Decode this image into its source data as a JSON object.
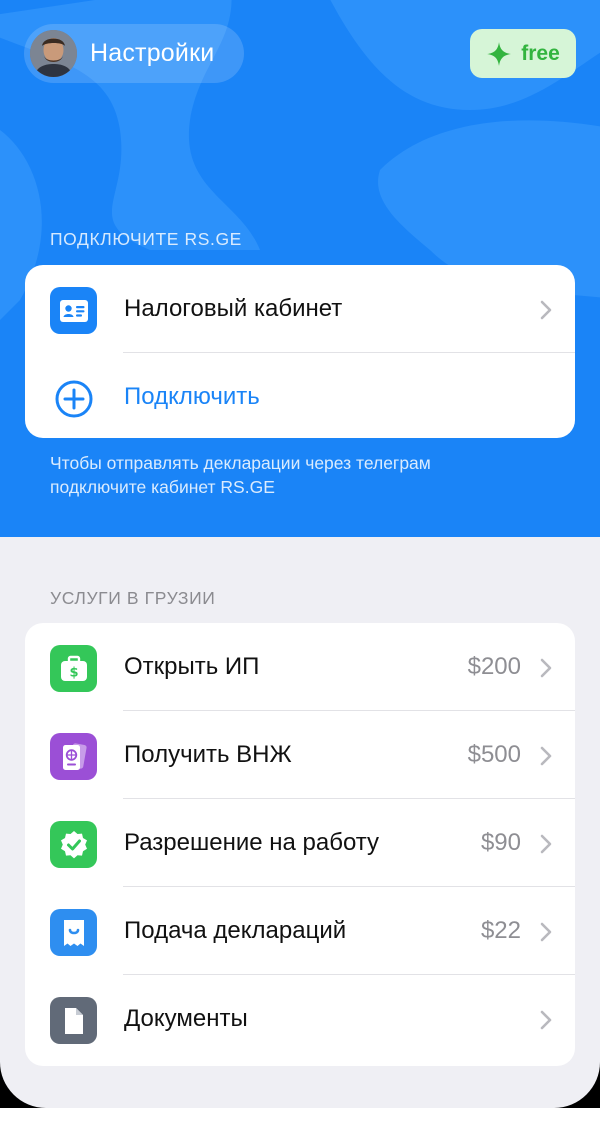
{
  "header": {
    "title": "Настройки",
    "plan_badge": "free"
  },
  "rs_section": {
    "title": "ПОДКЛЮЧИТЕ RS.GE",
    "items": [
      {
        "label": "Налоговый кабинет",
        "icon": "id-card-icon"
      },
      {
        "label": "Подключить",
        "icon": "plus-circle-icon"
      }
    ],
    "hint_line1": "Чтобы отправлять декларации через телеграм",
    "hint_line2": "подключите кабинет RS.GE"
  },
  "services_section": {
    "title": "УСЛУГИ В ГРУЗИИ",
    "items": [
      {
        "label": "Открыть ИП",
        "price": "$200",
        "icon": "briefcase-dollar-icon",
        "color": "#34c759"
      },
      {
        "label": "Получить ВНЖ",
        "price": "$500",
        "icon": "passport-icon",
        "color": "#9b4fd6"
      },
      {
        "label": "Разрешение на работу",
        "price": "$90",
        "icon": "verified-badge-icon",
        "color": "#34c759"
      },
      {
        "label": "Подача деклараций",
        "price": "$22",
        "icon": "receipt-icon",
        "color": "#2e8ef0"
      },
      {
        "label": "Документы",
        "price": "",
        "icon": "document-icon",
        "color": "#616a78"
      }
    ]
  },
  "colors": {
    "accent": "#1a84f7",
    "free_badge_bg": "#d6f5d7",
    "free_badge_text": "#33b43f"
  }
}
